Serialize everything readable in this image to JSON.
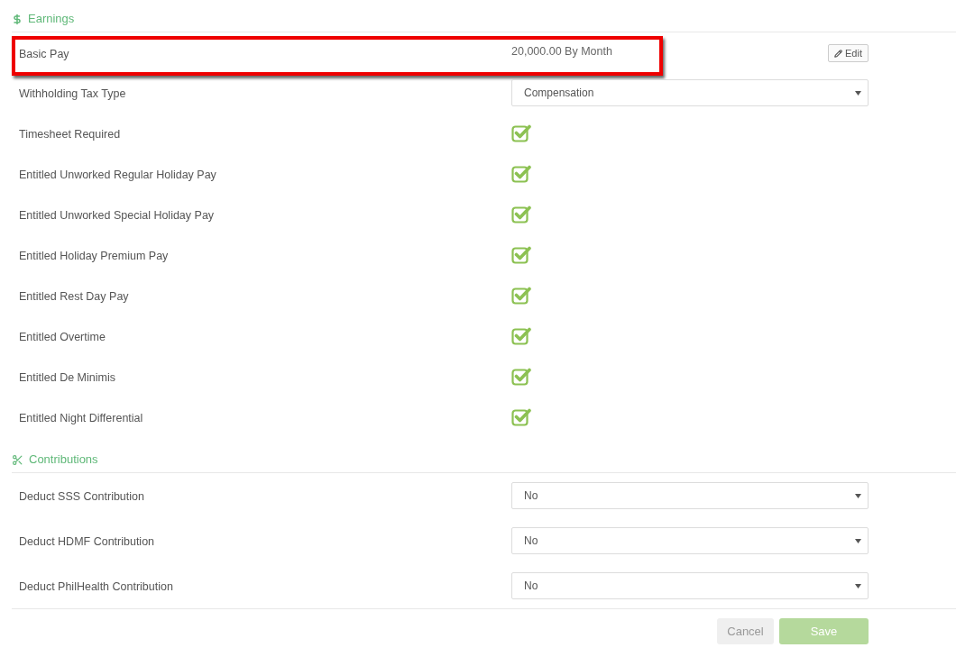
{
  "sections": [
    {
      "kind": "earnings",
      "title": "Earnings",
      "rows": [
        {
          "kind": "text",
          "label": "Basic Pay",
          "value": "20,000.00 By Month",
          "action": "Edit",
          "highlighted": true
        },
        {
          "kind": "select",
          "label": "Withholding Tax Type",
          "value": "Compensation",
          "highlighted": false
        },
        {
          "kind": "checkbox",
          "label": "Timesheet Required",
          "checked": true,
          "highlighted": false
        },
        {
          "kind": "checkbox",
          "label": "Entitled Unworked Regular Holiday Pay",
          "checked": true,
          "highlighted": false
        },
        {
          "kind": "checkbox",
          "label": "Entitled Unworked Special Holiday Pay",
          "checked": true,
          "highlighted": false
        },
        {
          "kind": "checkbox",
          "label": "Entitled Holiday Premium Pay",
          "checked": true,
          "highlighted": false
        },
        {
          "kind": "checkbox",
          "label": "Entitled Rest Day Pay",
          "checked": true,
          "highlighted": false
        },
        {
          "kind": "checkbox",
          "label": "Entitled Overtime",
          "checked": true,
          "highlighted": false
        },
        {
          "kind": "checkbox",
          "label": "Entitled De Minimis",
          "checked": true,
          "highlighted": false
        },
        {
          "kind": "checkbox",
          "label": "Entitled Night Differential",
          "checked": true,
          "highlighted": false
        }
      ]
    },
    {
      "kind": "contributions",
      "title": "Contributions",
      "rows": [
        {
          "kind": "select",
          "label": "Deduct SSS Contribution",
          "value": "No",
          "highlighted": false
        },
        {
          "kind": "select",
          "label": "Deduct HDMF Contribution",
          "value": "No",
          "highlighted": false
        },
        {
          "kind": "select",
          "label": "Deduct PhilHealth Contribution",
          "value": "No",
          "highlighted": false
        }
      ]
    }
  ],
  "buttons": [
    {
      "kind": "secondary",
      "label": "Cancel",
      "disabled": false
    },
    {
      "kind": "primary",
      "label": "Save",
      "disabled": true
    }
  ]
}
